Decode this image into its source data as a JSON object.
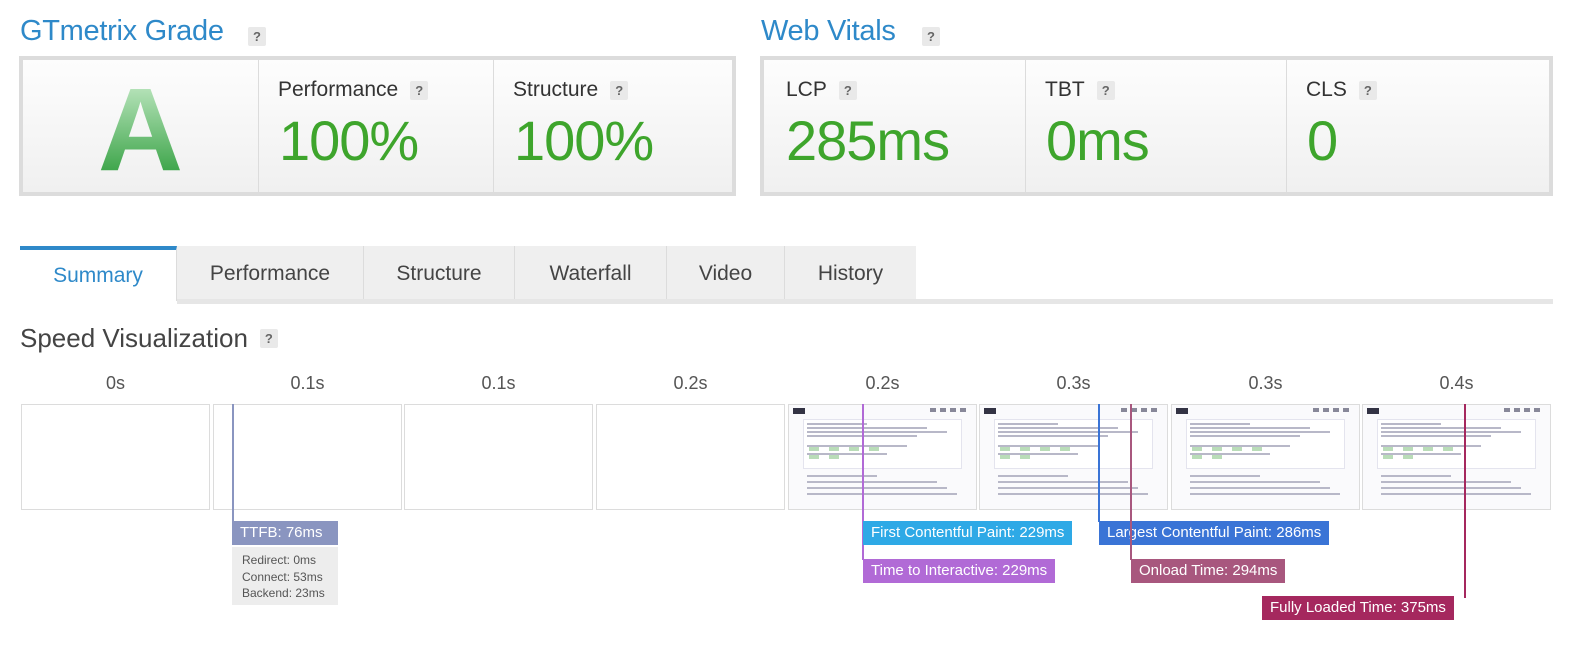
{
  "grade": {
    "title": "GTmetrix Grade",
    "help": "?",
    "letter": "A",
    "performance": {
      "label": "Performance",
      "value": "100%"
    },
    "structure": {
      "label": "Structure",
      "value": "100%"
    }
  },
  "vitals": {
    "title": "Web Vitals",
    "help": "?",
    "lcp": {
      "label": "LCP",
      "value": "285ms"
    },
    "tbt": {
      "label": "TBT",
      "value": "0ms"
    },
    "cls": {
      "label": "CLS",
      "value": "0"
    }
  },
  "tabs": [
    {
      "label": "Summary",
      "active": true
    },
    {
      "label": "Performance"
    },
    {
      "label": "Structure"
    },
    {
      "label": "Waterfall"
    },
    {
      "label": "Video"
    },
    {
      "label": "History"
    }
  ],
  "speed": {
    "title": "Speed Visualization",
    "ticks": [
      "0s",
      "0.1s",
      "0.1s",
      "0.2s",
      "0.2s",
      "0.3s",
      "0.3s",
      "0.4s"
    ],
    "markers": {
      "ttfb": "TTFB: 76ms",
      "fcp": "First Contentful Paint: 229ms",
      "tti": "Time to Interactive: 229ms",
      "lcp": "Largest Contentful Paint: 286ms",
      "onload": "Onload Time: 294ms",
      "fully": "Fully Loaded Time: 375ms"
    },
    "ttfb_details": [
      "Redirect: 0ms",
      "Connect: 53ms",
      "Backend: 23ms"
    ]
  },
  "colors": {
    "accent": "#2e89c9",
    "value_green": "#3ea52c",
    "ttfb": "#8a95c0",
    "fcp": "#2ea9e6",
    "tti": "#b16ad6",
    "lcp": "#3a74d6",
    "onload": "#a8577e",
    "fully": "#a5285e"
  }
}
